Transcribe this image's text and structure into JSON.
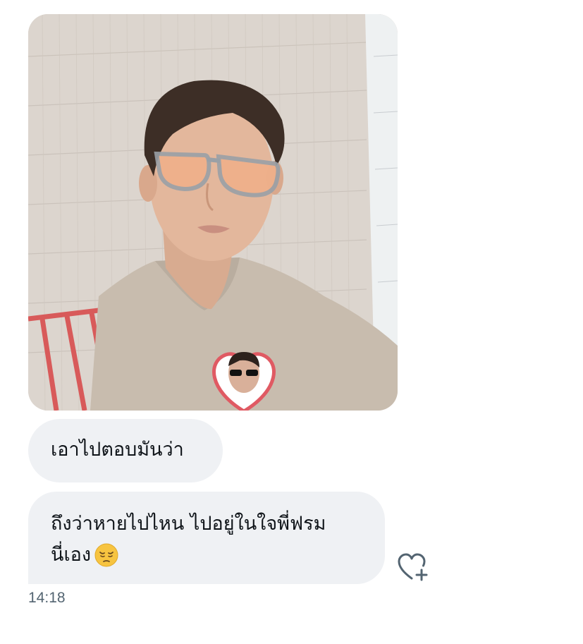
{
  "messages": [
    {
      "type": "image",
      "alt": ""
    },
    {
      "type": "text",
      "text": "เอาไปตอบมันว่า"
    },
    {
      "type": "text",
      "line1": "ถึงว่าหายไปไหน ไปอยู่ในใจพี่ฟรม",
      "line2": "นี่เอง"
    }
  ],
  "emoji": "pensive-face",
  "reaction_icon": "heart-plus-icon",
  "timestamp": "14:18",
  "colors": {
    "bubble_bg": "#eff1f4",
    "text": "#0f1419",
    "timestamp": "#536471",
    "heart_frame": "#e05a63"
  }
}
